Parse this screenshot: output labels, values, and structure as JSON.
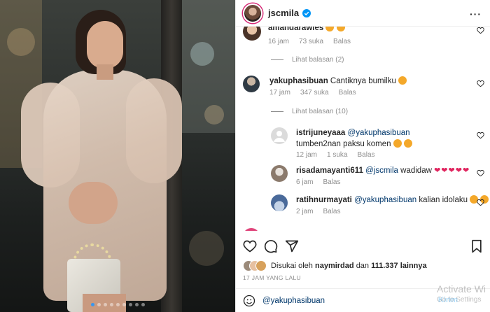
{
  "post": {
    "author": "jscmila",
    "carousel": {
      "count": 9,
      "active_index": 0
    }
  },
  "comments": [
    {
      "user": "amandarawles",
      "text": "",
      "time": "16 jam",
      "likes": "73 suka",
      "reply": "Balas",
      "partial": true
    },
    {
      "user": "yakuphasibuan",
      "text": "Cantiknya bumilku",
      "time": "17 jam",
      "likes": "347 suka",
      "reply": "Balas",
      "view_replies": "Lihat balasan (10)"
    },
    {
      "user": "istrijuneyaaa",
      "mention": "@yakuphasibuan",
      "text": "tumben2nan paksu komen",
      "time": "12 jam",
      "likes": "1 suka",
      "reply": "Balas"
    },
    {
      "user": "risadamayanti611",
      "mention": "@jscmila",
      "text": "wadidaw",
      "time": "6 jam",
      "reply": "Balas"
    },
    {
      "user": "ratihnurmayati",
      "mention": "@yakuphasibuan",
      "text": "kalian idolaku",
      "time": "2 jam",
      "reply": "Balas"
    }
  ],
  "view_replies_first": "Lihat balasan (2)",
  "likes_line": {
    "prefix": "Disukai oleh",
    "user": "naymirdad",
    "middle": "dan",
    "count": "111.337 lainnya"
  },
  "timestamp": "17 JAM YANG LALU",
  "composer": {
    "value": "@yakuphasibuan",
    "post_label": "Kirim"
  },
  "watermark": {
    "line1": "Activate Wi",
    "line2": "Go to Settings"
  },
  "icons": {
    "like": "heart-icon",
    "comment": "comment-icon",
    "share": "paper-plane-icon",
    "save": "bookmark-icon",
    "emoji": "smiley-icon",
    "more": "more-icon",
    "verified": "verified-badge-icon"
  },
  "colors": {
    "accent": "#0095f6",
    "link": "#00376b",
    "muted": "#8e8e8e",
    "verified": "#0095f6"
  }
}
